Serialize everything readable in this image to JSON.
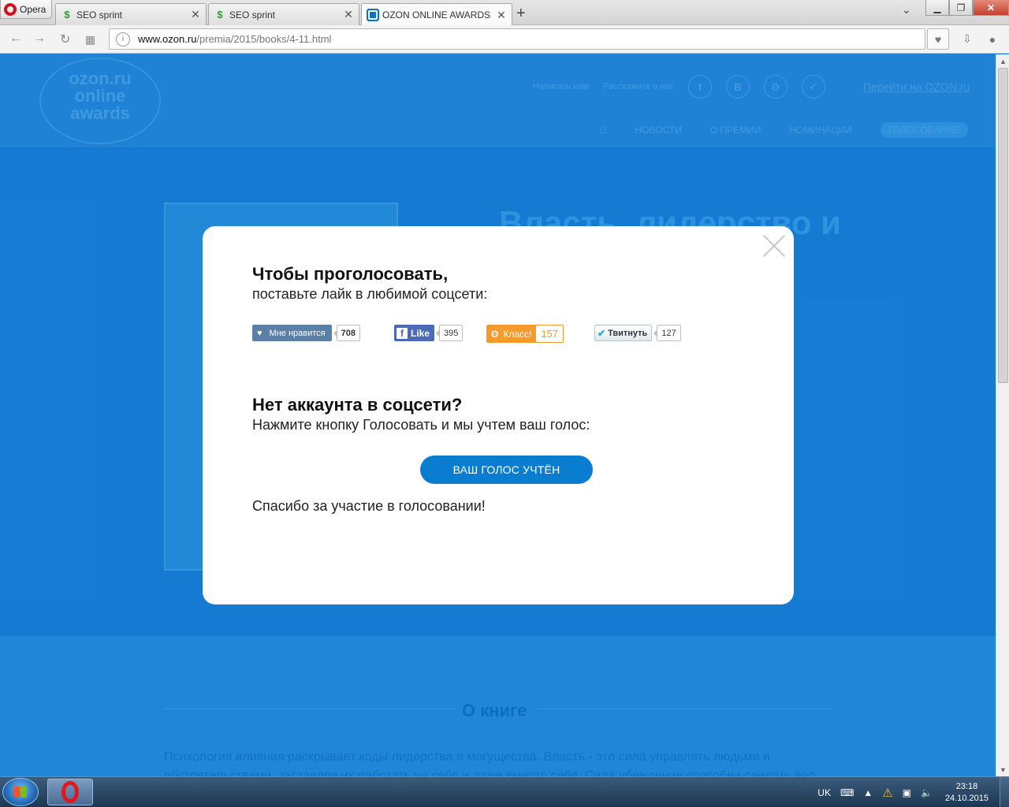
{
  "browser": {
    "menu_label": "Opera",
    "tabs": [
      {
        "title": "SEO sprint",
        "favicon": "seo-sprint-icon"
      },
      {
        "title": "SEO sprint",
        "favicon": "seo-sprint-icon"
      },
      {
        "title": "OZON ONLINE AWARDS",
        "favicon": "ozon-icon",
        "active": true
      }
    ],
    "new_tab": "+",
    "url_host": "www.ozon.ru",
    "url_path": "/premia/2015/books/4-11.html"
  },
  "page": {
    "logo_lines": [
      "ozon.ru",
      "online",
      "awards"
    ],
    "top_links": {
      "write_us": "Написать нам",
      "tell_about": "Расскажите о нас",
      "go_to_ozon": "Перейти на OZON.ru"
    },
    "social_icons": [
      "f",
      "B",
      "ok",
      "tw"
    ],
    "menu": {
      "news": "НОВОСТИ",
      "about_prize": "О ПРЕМИИ",
      "nominations": "НОМИНАЦИИ",
      "voting": "ГОЛОСОВАНИЕ"
    },
    "hero_title": "Власть, лидерство и",
    "about_title": "О книге",
    "about_text": "Психология влияния раскрывает коды лидерства и могущества. Власть - это сила управлять людьми и обстоятельствами, заставляя их работать на себя и даже вместо себя. Сила убеждения способна сделать вас непобедимым."
  },
  "modal": {
    "heading1": "Чтобы проголосовать,",
    "sub1": "поставьте лайк в любимой соцсети:",
    "social": {
      "vk_label": "Мне нравится",
      "vk_count": "708",
      "fb_label": "Like",
      "fb_count": "395",
      "ok_label": "Класс!",
      "ok_count": "157",
      "tw_label": "Твитнуть",
      "tw_count": "127"
    },
    "heading2": "Нет аккаунта в соцсети?",
    "sub2": "Нажмите кнопку Голосовать и мы учтем ваш голос:",
    "vote_button": "ВАШ ГОЛОС УЧТЁН",
    "thanks": "Спасибо за участие в голосовании!"
  },
  "taskbar": {
    "lang": "UK",
    "time": "23:18",
    "date": "24.10.2015"
  },
  "colors": {
    "page_bg": "#1c86dd",
    "vote_button": "#0b7dd1",
    "vk": "#5b7fa6",
    "fb": "#4c69ba",
    "ok": "#f59a2d"
  }
}
